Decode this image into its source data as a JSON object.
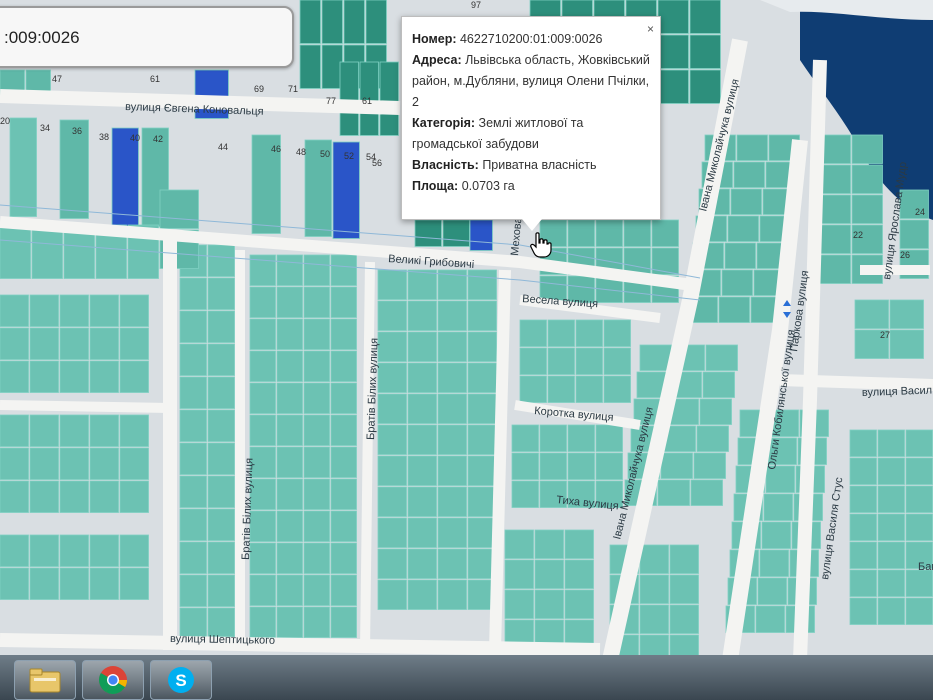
{
  "search": {
    "value": ":009:0026"
  },
  "popup": {
    "close_label": "×",
    "rows": [
      {
        "label": "Номер:",
        "value": "4622710200:01:009:0026"
      },
      {
        "label": "Адреса:",
        "value": "Львівська область, Жовківський район, м.Дубляни, вулиця Олени Пчілки, 2"
      },
      {
        "label": "Категорія:",
        "value": "Землі житлової та громадської забудови"
      },
      {
        "label": "Власність:",
        "value": "Приватна власність"
      },
      {
        "label": "Площа:",
        "value": "0.0703 га"
      }
    ]
  },
  "streets": [
    "вулиця Євгена Коновальця",
    "Великі Грибовичі",
    "Мехова",
    "Весела вулиця",
    "Коротка вулиця",
    "Тиха вулиця",
    "Братів Білих вулиця",
    "Братів Білих вулиця",
    "вулиця Шептицького",
    "Івана Миколайчука вулиця",
    "Івана Миколайчука вулиця",
    "Ольги Кобилянської вулиця",
    "Паркова вулиця",
    "вулиця Ярослава Мудр",
    "вулиця Васил",
    "вулиця Василя Стус",
    "Бан"
  ],
  "parcel_numbers": [
    "47",
    "69",
    "71",
    "77",
    "61",
    "34",
    "36",
    "38",
    "40",
    "42",
    "44",
    "46",
    "48",
    "50",
    "52",
    "54",
    "56",
    "61",
    "97",
    "22",
    "27",
    "24",
    "26",
    "20"
  ],
  "taskbar": {
    "apps": [
      "explorer-icon",
      "chrome-icon",
      "skype-icon"
    ]
  },
  "colors": {
    "parcel": "#5fb8a8",
    "parcel_dark": "#2d8f7c",
    "parcel_blue": "#2a55c8",
    "water": "#0f3d73",
    "road": "#f3f3f1",
    "background": "#dfe3e6"
  }
}
